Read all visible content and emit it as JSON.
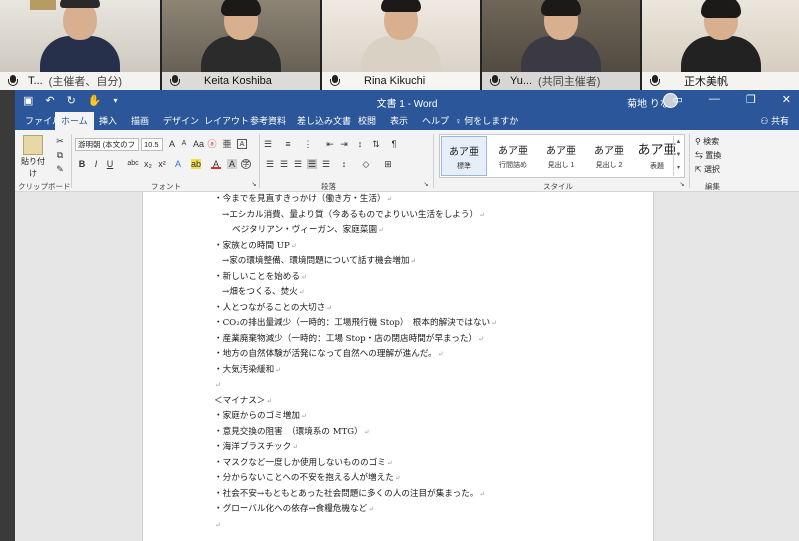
{
  "participants": [
    {
      "name": "T...",
      "role": "(主催者、自分)"
    },
    {
      "name": "Keita Koshiba",
      "role": ""
    },
    {
      "name": "Rina Kikuchi",
      "role": ""
    },
    {
      "name": "Yu...",
      "role": "(共同主催者)"
    },
    {
      "name": "正木美帆",
      "role": ""
    }
  ],
  "word": {
    "title": "文書 1  -  Word",
    "user": "菊地 りな",
    "tabs": [
      "ファイル",
      "ホーム",
      "挿入",
      "描画",
      "デザイン",
      "レイアウト",
      "参考資料",
      "差し込み文書",
      "校閲",
      "表示",
      "ヘルプ",
      "何をしますか"
    ],
    "share": "共有",
    "ribbon": {
      "paste": "貼り付け",
      "font_name": "游明朝 (本文のフ",
      "font_size": "10.5",
      "groups": [
        "クリップボード",
        "フォント",
        "段落",
        "スタイル",
        "編集"
      ],
      "styles": [
        {
          "sample": "あア亜",
          "name": "標準"
        },
        {
          "sample": "あア亜",
          "name": "行間詰め"
        },
        {
          "sample": "あア亜",
          "name": "見出し 1"
        },
        {
          "sample": "あア亜",
          "name": "見出し 2"
        },
        {
          "sample": "あア亜",
          "name": "表題"
        }
      ],
      "editing": [
        "検索",
        "置換",
        "選択"
      ]
    }
  },
  "document": {
    "lines": [
      {
        "text": "・今までを見直すきっかけ（働き方・生活）",
        "indent": 0
      },
      {
        "text": "→エシカル消費、量より質（今あるものでよりいい生活をしよう）",
        "indent": 1
      },
      {
        "text": "ベジタリアン・ヴィーガン、家庭菜園",
        "indent": 2
      },
      {
        "text": "・家族との時間 UP",
        "indent": 0
      },
      {
        "text": "→家の環境整備、環境問題について話す機会増加",
        "indent": 1
      },
      {
        "text": "・新しいことを始める",
        "indent": 0
      },
      {
        "text": "→畑をつくる、焚火",
        "indent": 1
      },
      {
        "text": "・人とつながることの大切さ",
        "indent": 0
      },
      {
        "text": "・CO₂の排出量減少（一時的：工場飛行機 Stop）　根本的解決ではない",
        "indent": 0
      },
      {
        "text": "・産業廃棄物減少（一時的：工場 Stop・店の閉店時間が早まった）",
        "indent": 0
      },
      {
        "text": "・地方の自然体験が活発になって自然への理解が進んだ。",
        "indent": 0
      },
      {
        "text": "・大気汚染緩和",
        "indent": 0
      },
      {
        "text": "",
        "indent": 0
      },
      {
        "text": "＜マイナス＞",
        "indent": 0
      },
      {
        "text": "・家庭からのゴミ増加",
        "indent": 0
      },
      {
        "text": "・意見交換の阻害　（環境系の MTG）",
        "indent": 0
      },
      {
        "text": "・海洋プラスチック",
        "indent": 0
      },
      {
        "text": "・マスクなど一度しか使用しないもののゴミ",
        "indent": 0
      },
      {
        "text": "・分からないことへの不安を抱える人が増えた",
        "indent": 0
      },
      {
        "text": "・社会不安→もともとあった社会問題に多くの人の注目が集まった。",
        "indent": 0
      },
      {
        "text": "・グローバル化への依存→食糧危機など",
        "indent": 0
      },
      {
        "text": "",
        "indent": 0
      }
    ]
  }
}
